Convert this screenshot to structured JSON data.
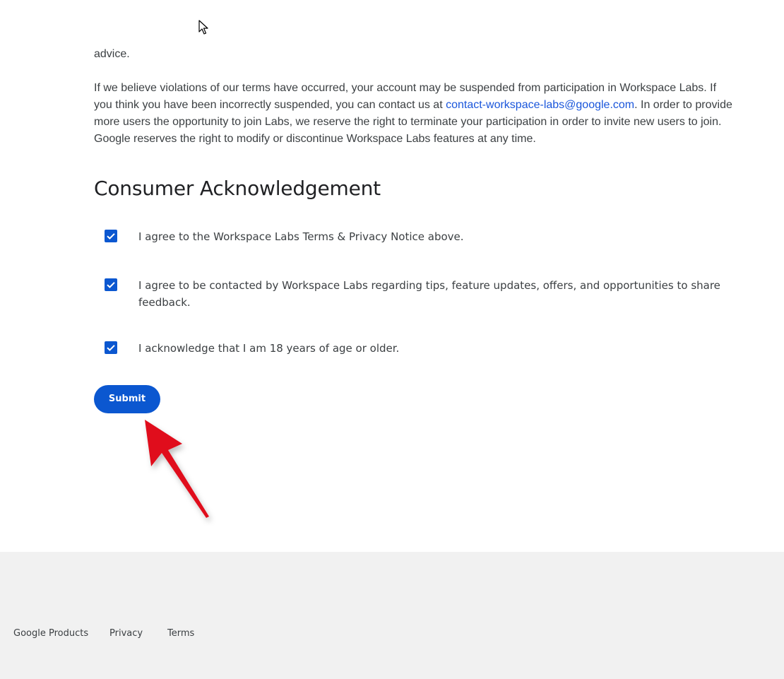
{
  "content": {
    "paragraph_top": "advice.",
    "paragraph_main_before_link": "If we believe violations of our terms have occurred, your account may be suspended from participation in Workspace Labs. If you think you have been incorrectly suspended, you can contact us at ",
    "contact_email": "contact-workspace-labs@google.com",
    "paragraph_main_after_link": ". In order to provide more users the opportunity to join Labs, we reserve the right to terminate your participation in order to invite new users to join. Google reserves the right to modify or discontinue Workspace Labs features at any time."
  },
  "acknowledgement": {
    "title": "Consumer Acknowledgement",
    "items": [
      {
        "label": "I agree to the Workspace Labs Terms & Privacy Notice above.",
        "checked": true
      },
      {
        "label": "I agree to be contacted by Workspace Labs regarding tips, feature updates, offers, and opportunities to share feedback.",
        "checked": true
      },
      {
        "label": "I acknowledge that I am 18 years of age or older.",
        "checked": true
      }
    ],
    "submit_label": "Submit"
  },
  "footer": {
    "links": [
      "Google Products",
      "Privacy",
      "Terms"
    ]
  },
  "colors": {
    "accent": "#0b57d0",
    "link": "#1a56db",
    "annotation_arrow": "#e0101c",
    "footer_bg": "#f1f1f1"
  },
  "icons": {
    "checkbox": "check-icon",
    "annotation": "red-arrow-icon",
    "cursor": "mouse-pointer-icon"
  }
}
